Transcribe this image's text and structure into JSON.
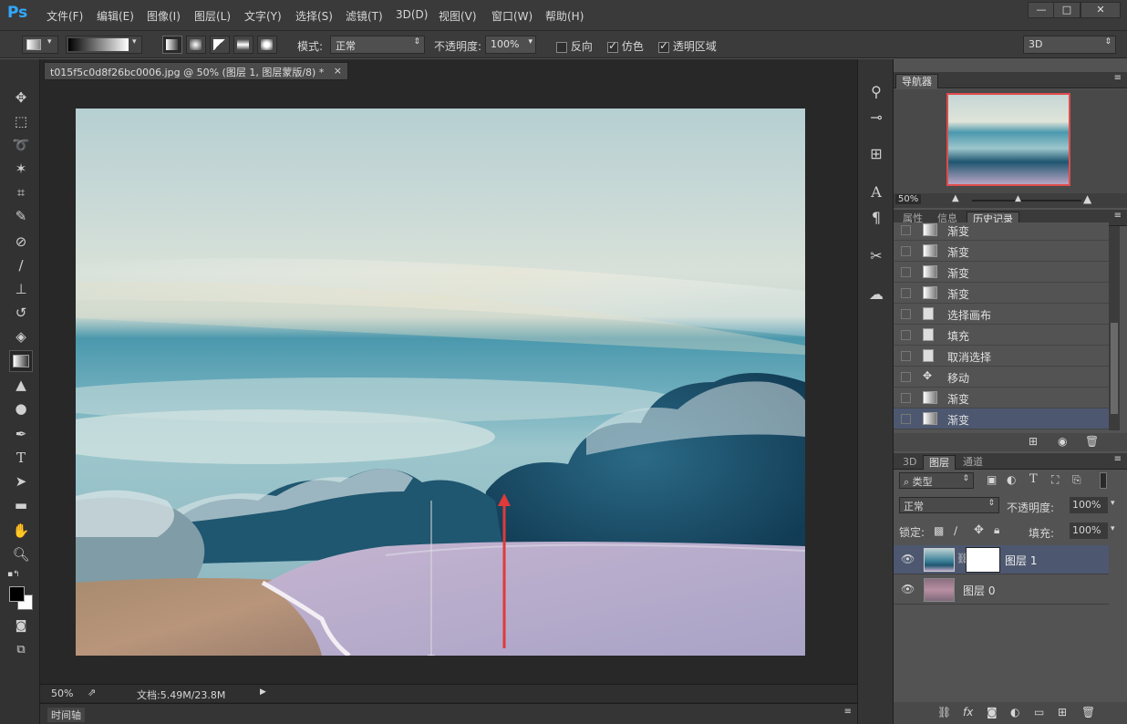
{
  "app": {
    "logo": "Ps"
  },
  "menu": [
    "文件(F)",
    "编辑(E)",
    "图像(I)",
    "图层(L)",
    "文字(Y)",
    "选择(S)",
    "滤镜(T)",
    "3D(D)",
    "视图(V)",
    "窗口(W)",
    "帮助(H)"
  ],
  "window_controls": {
    "minimize": "—",
    "restore": "□",
    "close": "✕"
  },
  "options": {
    "mode_label": "模式:",
    "mode_value": "正常",
    "opacity_label": "不透明度:",
    "opacity_value": "100%",
    "reverse_label": "反向",
    "dither_label": "仿色",
    "transparency_label": "透明区域",
    "workspace_value": "3D",
    "reverse_checked": false,
    "dither_checked": true,
    "transparency_checked": true
  },
  "document": {
    "tab_title": "t015f5c0d8f26bc0006.jpg @ 50% (图层 1, 图层蒙版/8) *",
    "close": "×",
    "zoom": "50%",
    "doc_info": "文档:5.49M/23.8M",
    "timeline_label": "时间轴"
  },
  "navigator": {
    "tab": "导航器",
    "zoom": "50%"
  },
  "history": {
    "tabs": [
      "属性",
      "信息",
      "历史记录"
    ],
    "items": [
      {
        "label": "渐变",
        "icon": "gradient-icon"
      },
      {
        "label": "渐变",
        "icon": "gradient-icon"
      },
      {
        "label": "渐变",
        "icon": "gradient-icon"
      },
      {
        "label": "渐变",
        "icon": "gradient-icon"
      },
      {
        "label": "选择画布",
        "icon": "document-icon"
      },
      {
        "label": "填充",
        "icon": "fill-icon"
      },
      {
        "label": "取消选择",
        "icon": "document-icon"
      },
      {
        "label": "移动",
        "icon": "move-icon"
      },
      {
        "label": "渐变",
        "icon": "gradient-icon"
      },
      {
        "label": "渐变",
        "icon": "gradient-icon"
      }
    ],
    "selected_index": 9
  },
  "layers": {
    "tabs": [
      "3D",
      "图层",
      "通道"
    ],
    "filter_label": "类型",
    "blend_mode": "正常",
    "opacity_label": "不透明度:",
    "opacity_value": "100%",
    "lock_label": "锁定:",
    "fill_label": "填充:",
    "fill_value": "100%",
    "items": [
      {
        "name": "图层 1",
        "has_mask": true,
        "selected": true
      },
      {
        "name": "图层 0",
        "has_mask": false,
        "selected": false
      }
    ]
  },
  "colors": {
    "accent_arrow": "#e03a3a",
    "selected_row": "#4d5870"
  }
}
